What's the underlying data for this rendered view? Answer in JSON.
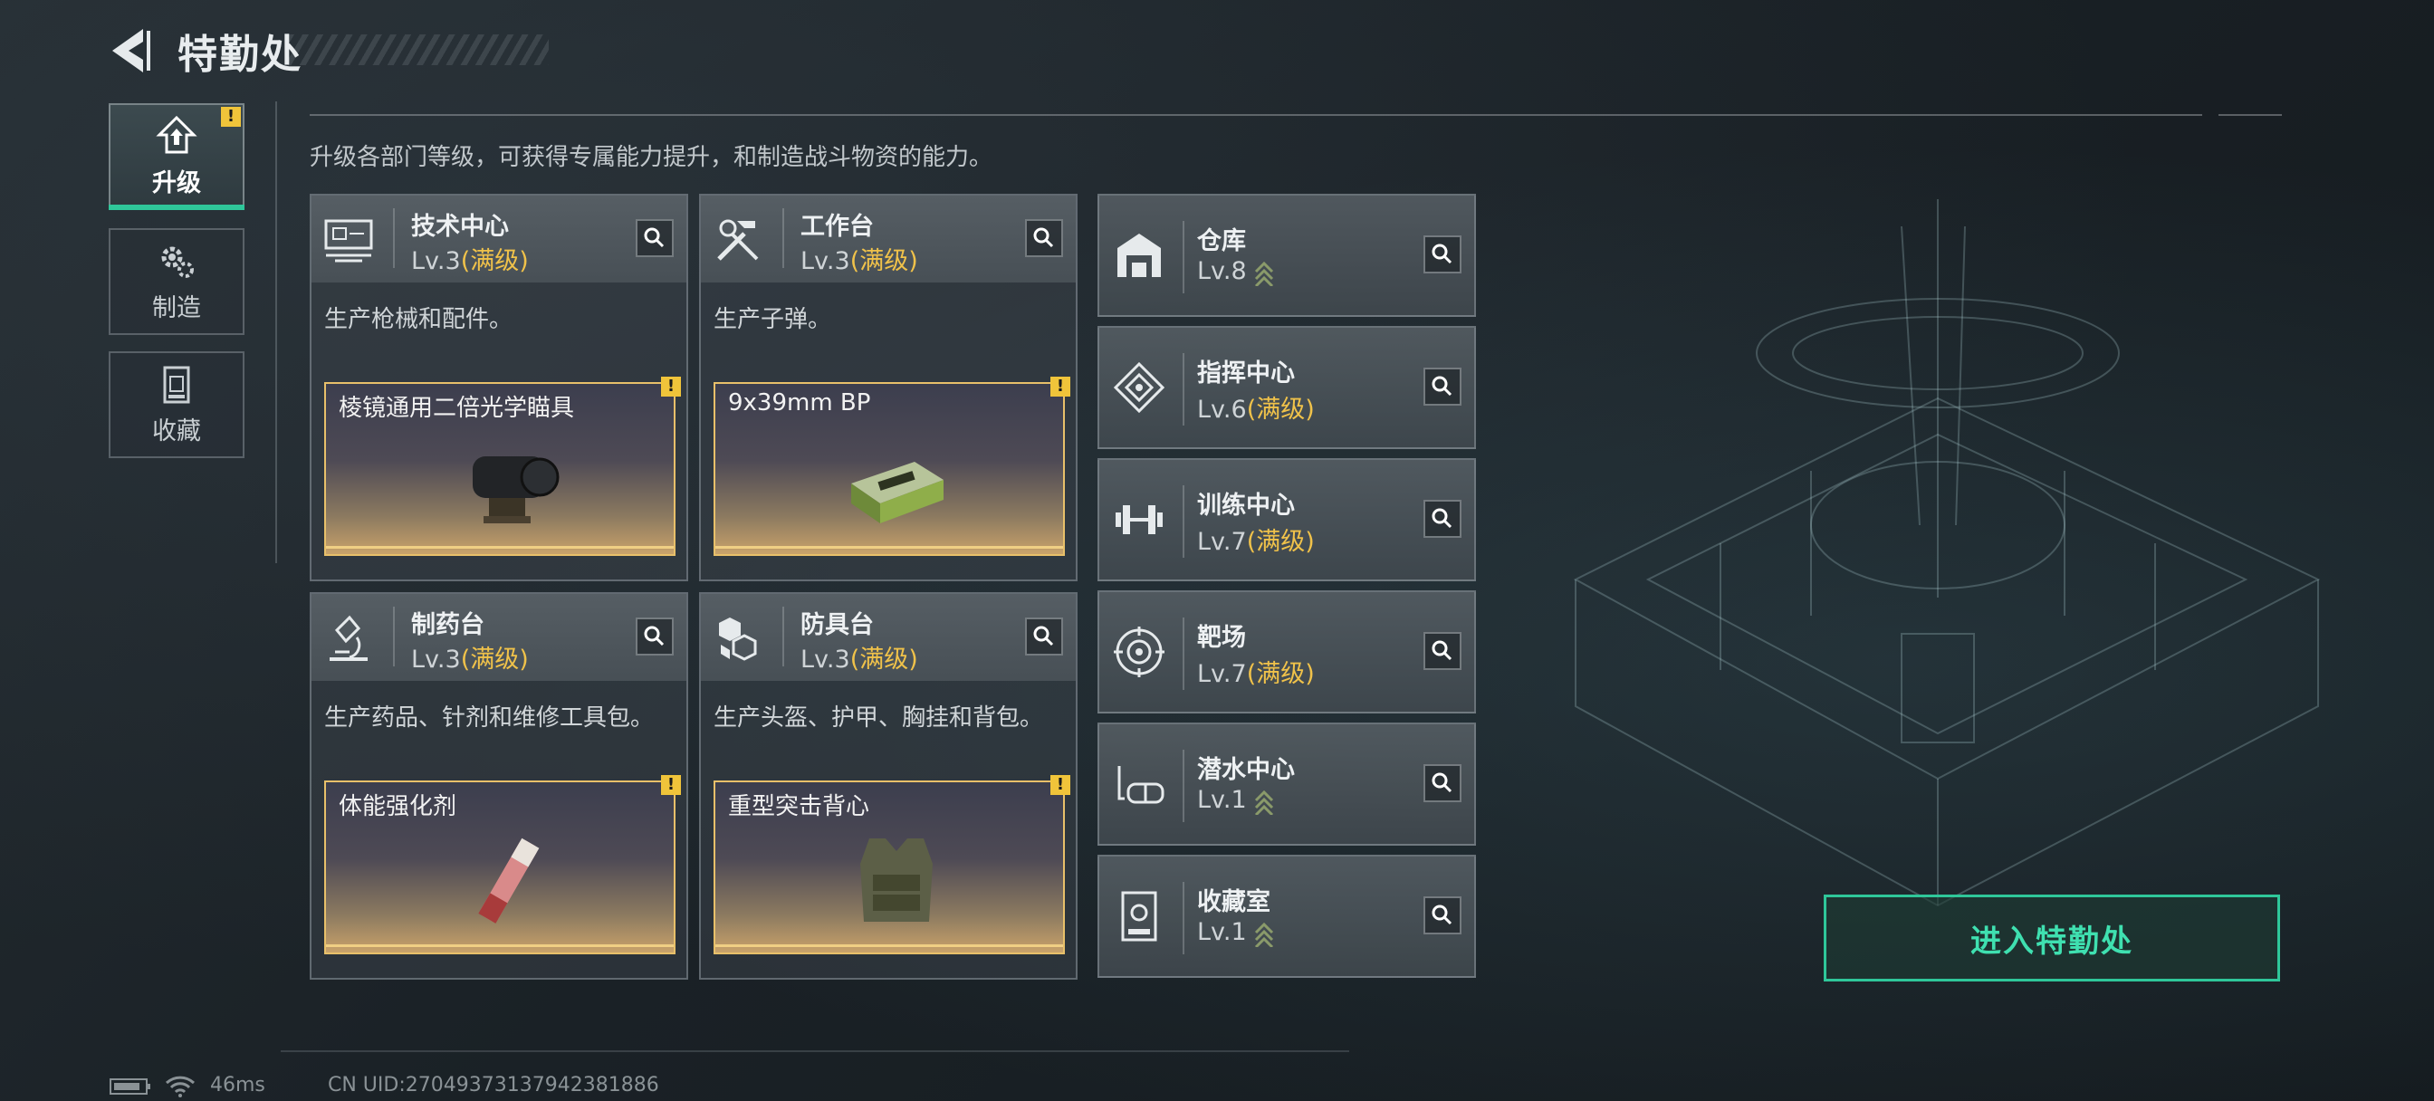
{
  "header": {
    "title": "特勤处"
  },
  "nav": [
    {
      "label": "升级",
      "active": true,
      "badge": "!"
    },
    {
      "label": "制造",
      "active": false
    },
    {
      "label": "收藏",
      "active": false
    }
  ],
  "description": "升级各部门等级，可获得专属能力提升，和制造战斗物资的能力。",
  "departments": [
    {
      "name": "技术中心",
      "level": "Lv.3",
      "status": "(满级)",
      "desc": "生产枪械和配件。",
      "product": "棱镜通用二倍光学瞄具",
      "product_badge": "!"
    },
    {
      "name": "工作台",
      "level": "Lv.3",
      "status": "(满级)",
      "desc": "生产子弹。",
      "product": "9x39mm BP",
      "product_badge": "!"
    },
    {
      "name": "制药台",
      "level": "Lv.3",
      "status": "(满级)",
      "desc": "生产药品、针剂和维修工具包。",
      "product": "体能强化剂",
      "product_badge": "!"
    },
    {
      "name": "防具台",
      "level": "Lv.3",
      "status": "(满级)",
      "desc": "生产头盔、护甲、胸挂和背包。",
      "product": "重型突击背心",
      "product_badge": "!"
    }
  ],
  "facilities": [
    {
      "name": "仓库",
      "level": "Lv.8",
      "status": "",
      "upgradable": true
    },
    {
      "name": "指挥中心",
      "level": "Lv.6",
      "status": "(满级)",
      "upgradable": false
    },
    {
      "name": "训练中心",
      "level": "Lv.7",
      "status": "(满级)",
      "upgradable": false
    },
    {
      "name": "靶场",
      "level": "Lv.7",
      "status": "(满级)",
      "upgradable": false
    },
    {
      "name": "潜水中心",
      "level": "Lv.1",
      "status": "",
      "upgradable": true
    },
    {
      "name": "收藏室",
      "level": "Lv.1",
      "status": "",
      "upgradable": true
    }
  ],
  "enter_button": "进入特勤处",
  "status_bar": {
    "ping": "46ms",
    "uid": "CN UID:27049373137942381886"
  },
  "colors": {
    "accent": "#2fc79a",
    "maxed": "#f0c24a",
    "warning": "#f0c43a"
  },
  "icons": {
    "nav": [
      "upgrade-icon",
      "craft-gear-icon",
      "collection-icon"
    ],
    "departments": [
      "tech-center-icon",
      "workbench-tools-icon",
      "pharmacy-microscope-icon",
      "armor-bench-icon"
    ],
    "facilities": [
      "warehouse-icon",
      "command-center-icon",
      "training-dumbbell-icon",
      "shooting-range-icon",
      "diving-mask-icon",
      "collection-room-icon"
    ]
  }
}
